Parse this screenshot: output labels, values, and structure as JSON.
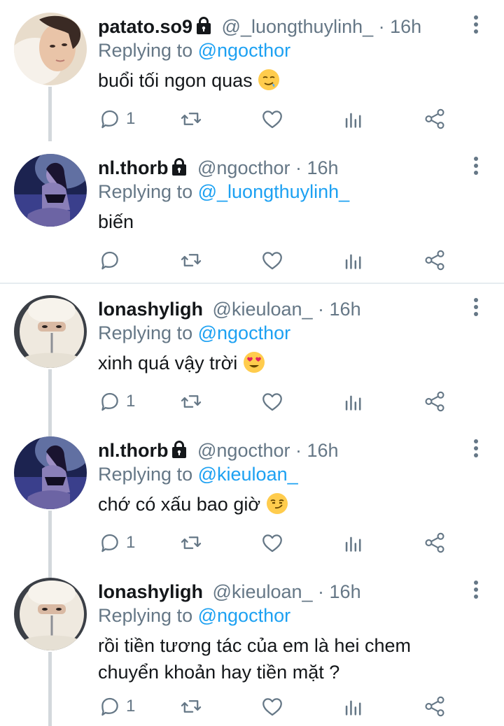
{
  "tweets": [
    {
      "name": "patato.so9",
      "handle": "@_luongthuylinh_ · 16h",
      "reply_prefix": "Replying to",
      "reply_to": "@ngocthor",
      "text": "buổi tối ngon quas",
      "emoji": "drooling-face",
      "reply_count": "1",
      "avatar": "woman-lying-on-pillow"
    },
    {
      "name": "nl.thorb",
      "handle": "@ngocthor · 16h",
      "reply_prefix": "Replying to",
      "reply_to": "@_luongthuylinh_",
      "text": "biến",
      "emoji": "",
      "reply_count": "",
      "avatar": "woman-in-blue-light"
    },
    {
      "name": "lonashyligh",
      "handle": "@kieuloan_ · 16h",
      "reply_prefix": "Replying to",
      "reply_to": "@ngocthor",
      "text": "xinh quá vậy trời",
      "emoji": "heart-eyes-face",
      "reply_count": "1",
      "avatar": "person-in-fur-hood"
    },
    {
      "name": "nl.thorb",
      "handle": "@ngocthor · 16h",
      "reply_prefix": "Replying to",
      "reply_to": "@kieuloan_",
      "text": "chớ có xấu bao giờ",
      "emoji": "smirking-face",
      "reply_count": "1",
      "avatar": "woman-in-blue-light"
    },
    {
      "name": "lonashyligh",
      "handle": "@kieuloan_ · 16h",
      "reply_prefix": "Replying to",
      "reply_to": "@ngocthor",
      "text_line1": "rồi tiền tương tác của em là hei chem",
      "text_line2": "chuyển khoản hay tiền mặt ?",
      "reply_count": "1",
      "avatar": "person-in-fur-hood"
    }
  ],
  "icons": [
    "lock-icon",
    "reply-icon",
    "retweet-icon",
    "like-icon",
    "analytics-icon",
    "share-icon",
    "more-icon"
  ],
  "colors": {
    "link": "#1da1f2",
    "secondary": "#657786",
    "thread_line": "#d3d8dc",
    "divider": "#e6ecf0"
  }
}
